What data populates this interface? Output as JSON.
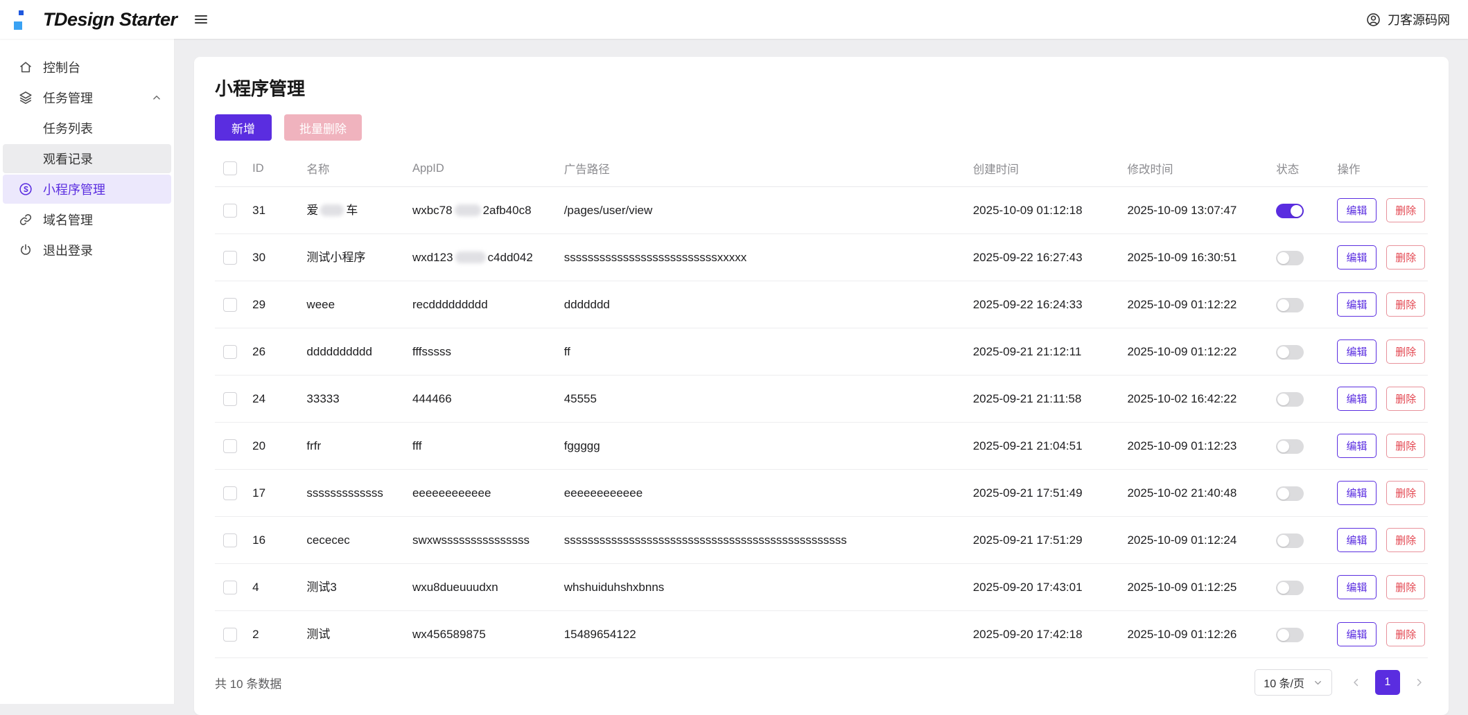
{
  "header": {
    "brand": "TDesign Starter",
    "user_name": "刀客源码网"
  },
  "sidebar": {
    "console": "控制台",
    "task_management": "任务管理",
    "task_list": "任务列表",
    "watch_records": "观看记录",
    "miniapp_management": "小程序管理",
    "domain_management": "域名管理",
    "logout": "退出登录"
  },
  "page": {
    "title": "小程序管理",
    "add_button": "新增",
    "batch_delete_button": "批量删除"
  },
  "table": {
    "columns": [
      "ID",
      "名称",
      "AppID",
      "广告路径",
      "创建时间",
      "修改时间",
      "状态",
      "操作"
    ],
    "edit_label": "编辑",
    "delete_label": "删除",
    "rows": [
      {
        "id": "31",
        "name": [
          {
            "t": "爱"
          },
          {
            "b": 34
          },
          {
            "t": "车"
          }
        ],
        "appid": [
          {
            "t": "wxbc78"
          },
          {
            "b": 38
          },
          {
            "t": "2afb40c8"
          }
        ],
        "path": "/pages/user/view",
        "created": "2025-10-09 01:12:18",
        "modified": "2025-10-09 13:07:47",
        "status_on": true
      },
      {
        "id": "30",
        "name": "测试小程序",
        "appid": [
          {
            "t": "wxd123"
          },
          {
            "b": 44
          },
          {
            "t": "c4dd042"
          }
        ],
        "path": "ssssssssssssssssssssssssssxxxxx",
        "created": "2025-09-22 16:27:43",
        "modified": "2025-10-09 16:30:51",
        "status_on": false
      },
      {
        "id": "29",
        "name": "weee",
        "appid": "recddddddddd",
        "path": "ddddddd",
        "created": "2025-09-22 16:24:33",
        "modified": "2025-10-09 01:12:22",
        "status_on": false
      },
      {
        "id": "26",
        "name": "dddddddddd",
        "appid": "fffsssss",
        "path": "ff",
        "created": "2025-09-21 21:12:11",
        "modified": "2025-10-09 01:12:22",
        "status_on": false
      },
      {
        "id": "24",
        "name": "33333",
        "appid": "444466",
        "path": "45555",
        "created": "2025-09-21 21:11:58",
        "modified": "2025-10-02 16:42:22",
        "status_on": false
      },
      {
        "id": "20",
        "name": "frfr",
        "appid": "fff",
        "path": "fggggg",
        "created": "2025-09-21 21:04:51",
        "modified": "2025-10-09 01:12:23",
        "status_on": false
      },
      {
        "id": "17",
        "name": "sssssssssssss",
        "appid": "eeeeeeeeeeee",
        "path": "eeeeeeeeeeee",
        "created": "2025-09-21 17:51:49",
        "modified": "2025-10-02 21:40:48",
        "status_on": false
      },
      {
        "id": "16",
        "name": "cececec",
        "appid": "swxwsssssssssssssss",
        "path": "ssssssssssssssssssssssssssssssssssssssssssssssss",
        "created": "2025-09-21 17:51:29",
        "modified": "2025-10-09 01:12:24",
        "status_on": false
      },
      {
        "id": "4",
        "name": "测试3",
        "appid": "wxu8dueuuudxn",
        "path": "whshuiduhshxbnns",
        "created": "2025-09-20 17:43:01",
        "modified": "2025-10-09 01:12:25",
        "status_on": false
      },
      {
        "id": "2",
        "name": "测试",
        "appid": "wx456589875",
        "path": "15489654122",
        "created": "2025-09-20 17:42:18",
        "modified": "2025-10-09 01:12:26",
        "status_on": false
      }
    ]
  },
  "footer": {
    "total_text": "共 10 条数据",
    "page_size": "10 条/页",
    "current_page": "1"
  },
  "colors": {
    "primary": "#5a2de0",
    "primary_light_bg": "#ece8fc",
    "danger_text": "#e3454f",
    "danger_disabled_bg": "#f0b3be",
    "toggle_off": "#dcdcde",
    "page_bg": "#eeeef0",
    "logo_blue_dark": "#1f58de",
    "logo_blue_light": "#3aa2f3"
  }
}
